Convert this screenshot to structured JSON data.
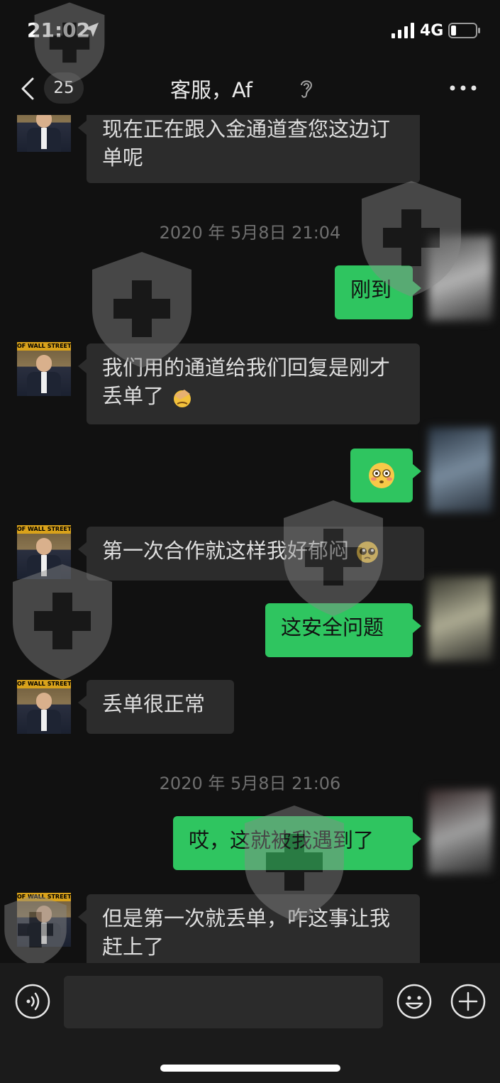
{
  "status_bar": {
    "time": "21:02",
    "network": "4G",
    "icons": [
      "location-arrow-icon",
      "signal-bars-icon",
      "battery-icon"
    ]
  },
  "nav": {
    "back_icon": "chevron-left-icon",
    "unread_count": "25",
    "title": "客服，Af",
    "ear_icon": "ear-icon",
    "more_icon": "more-dots-icon"
  },
  "avatar_banner": "OF WALL STREET",
  "messages": [
    {
      "side": "in",
      "text": "现在正在跟入金通道查您这边订单呢"
    },
    {
      "type": "timestamp",
      "text": "2020 年 5月8日 21:04"
    },
    {
      "side": "out",
      "text": "刚到"
    },
    {
      "side": "in",
      "text": "我们用的通道给我们回复是刚才丢单了",
      "emoji": "facepalm-emoji"
    },
    {
      "side": "out",
      "emoji": "flushed-face-emoji"
    },
    {
      "side": "in",
      "text": "第一次合作就这样我好郁闷",
      "emoji": "pleading-face-emoji"
    },
    {
      "side": "out",
      "text": "这安全问题"
    },
    {
      "side": "in",
      "text": "丢单很正常"
    },
    {
      "type": "timestamp",
      "text": "2020 年 5月8日 21:06"
    },
    {
      "side": "out",
      "text": "哎，这就被我遇到了"
    },
    {
      "side": "in",
      "text": "但是第一次就丢单，咋这事让我赶上了"
    }
  ],
  "input_bar": {
    "voice_icon": "voice-icon",
    "input_value": "",
    "emoji_icon": "smiley-icon",
    "plus_icon": "plus-icon"
  },
  "colors": {
    "background": "#111111",
    "incoming_bubble": "#2c2c2c",
    "outgoing_bubble": "#2fc560",
    "timestamp": "#6f6f6f"
  }
}
